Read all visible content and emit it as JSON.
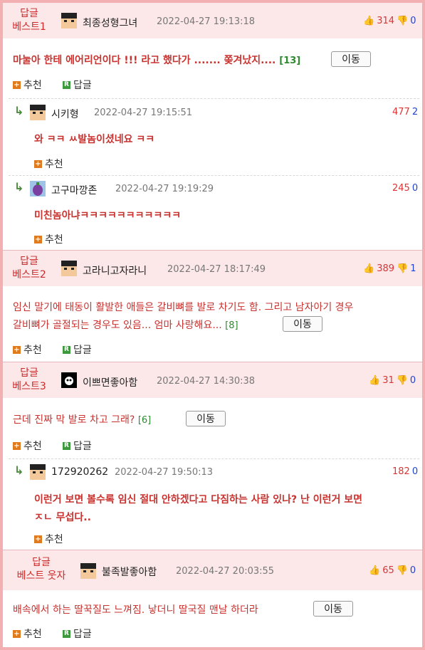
{
  "posts": [
    {
      "badge": [
        "답글",
        "베스트1"
      ],
      "user": "최종성형그녀",
      "date": "2022-04-27 19:13:18",
      "up": "314",
      "down": "0",
      "content": "마눌아 한테 에어리언이다 !!! 라고 했다가 ....... 쫒겨났지....",
      "count": "[13]",
      "move": "이동",
      "recommend": "추천",
      "reply": "답글",
      "replies": [
        {
          "user": "시키형",
          "date": "2022-04-27 19:15:51",
          "up": "477",
          "down": "2",
          "content": "와 ㅋㅋ ㅆ발놈이셨네요 ㅋㅋ",
          "recommend": "추천"
        },
        {
          "user": "고구마깡존",
          "date": "2022-04-27 19:19:29",
          "up": "245",
          "down": "0",
          "content": "미친놈아냐ㅋㅋㅋㅋㅋㅋㅋㅋㅋㅋㅋ",
          "recommend": "추천"
        }
      ]
    },
    {
      "badge": [
        "답글",
        "베스트2"
      ],
      "user": "고라니고자라니",
      "date": "2022-04-27 18:17:49",
      "up": "389",
      "down": "1",
      "content_lines": [
        "임신 말기에 태동이 활발한 애들은 갈비뼈를 발로 차기도 함. 그리고 남자아기 경우",
        "갈비뼈가 골절되는 경우도 있음... 엄마 사랑해요..."
      ],
      "count": "[8]",
      "move": "이동",
      "recommend": "추천",
      "reply": "답글"
    },
    {
      "badge": [
        "답글",
        "베스트3"
      ],
      "user": "이쁘면좋아함",
      "date": "2022-04-27 14:30:38",
      "up": "31",
      "down": "0",
      "content": "근데 진짜 막 발로 차고 그래?",
      "count": "[6]",
      "move": "이동",
      "recommend": "추천",
      "reply": "답글",
      "replies": [
        {
          "user": "172920262",
          "date": "2022-04-27 19:50:13",
          "up": "182",
          "down": "0",
          "content_lines": [
            "이런거 보면 볼수록 임신 절대 안하겠다고 다짐하는 사람 있나? 난 이런거 보면",
            "ㅈㄴ 무섭다.."
          ],
          "recommend": "추천"
        }
      ]
    },
    {
      "badge": [
        "답글",
        "베스트 웃자"
      ],
      "user": "불족발좋아함",
      "date": "2022-04-27 20:03:55",
      "up": "65",
      "down": "0",
      "content": "배속에서 하는 딸꾹질도 느껴짐. 낳더니 딸국질 맨날 하더라",
      "move": "이동",
      "recommend": "추천",
      "reply": "답글"
    }
  ],
  "icons": {
    "thumb_up": "thumbs-up-icon",
    "thumb_down": "thumbs-down-icon",
    "reply_arrow": "reply-arrow-icon",
    "plus": "plus-icon",
    "r": "reply-r-icon"
  },
  "colors": {
    "accent": "#cc2a2a",
    "header_bg": "#fde8e9",
    "border": "#f3b0b3",
    "recommend": "#e07a1e",
    "reply": "#3c9a3c"
  }
}
